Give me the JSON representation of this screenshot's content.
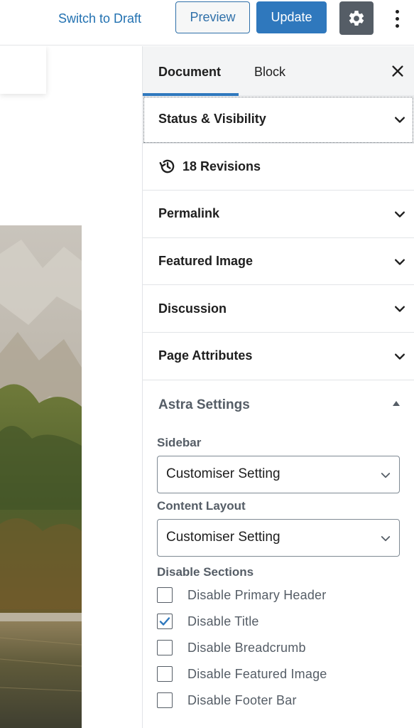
{
  "toolbar": {
    "switch_to_draft": "Switch to Draft",
    "preview": "Preview",
    "update": "Update",
    "settings_icon": "gear-icon",
    "more_icon": "vertical-ellipsis-icon"
  },
  "sidebar": {
    "tabs": {
      "document": "Document",
      "block": "Block"
    },
    "panels": {
      "status_visibility": "Status & Visibility",
      "revisions": "18 Revisions",
      "permalink": "Permalink",
      "featured_image": "Featured Image",
      "discussion": "Discussion",
      "page_attributes": "Page Attributes"
    },
    "astra": {
      "title": "Astra Settings",
      "sidebar_label": "Sidebar",
      "sidebar_value": "Customiser Setting",
      "content_layout_label": "Content Layout",
      "content_layout_value": "Customiser Setting",
      "disable_sections_label": "Disable Sections",
      "options": [
        {
          "label": "Disable Primary Header",
          "checked": false
        },
        {
          "label": "Disable Title",
          "checked": true
        },
        {
          "label": "Disable Breadcrumb",
          "checked": false
        },
        {
          "label": "Disable Featured Image",
          "checked": false
        },
        {
          "label": "Disable Footer Bar",
          "checked": false
        }
      ]
    }
  },
  "colors": {
    "accent": "#2f78bd",
    "settings_bg": "#555d66",
    "checkbox_check": "#2f78bd"
  }
}
